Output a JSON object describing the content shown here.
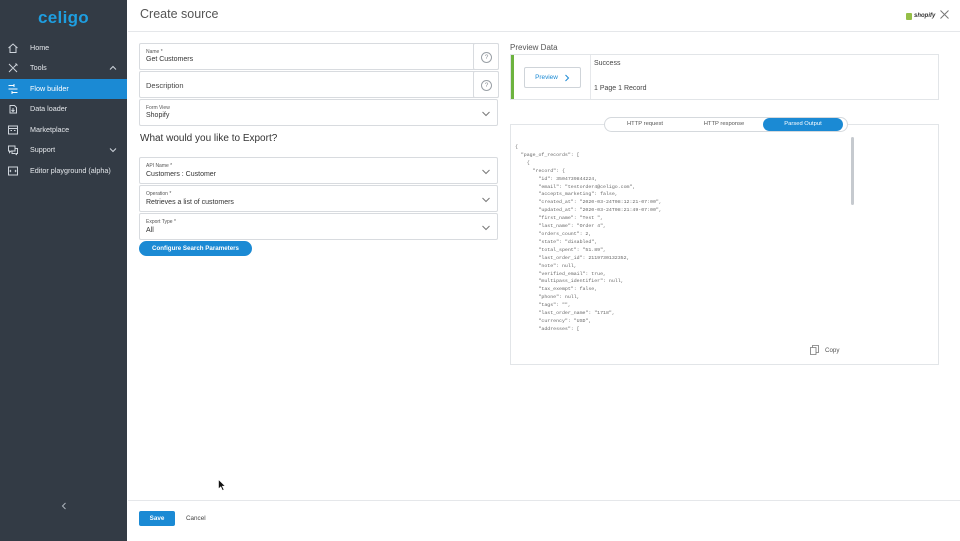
{
  "app": {
    "brand": "celigo",
    "brand_color": "#1e9ee0",
    "accent": "#1b8ad4",
    "success_color": "#6db33f"
  },
  "sidebar": {
    "items": [
      {
        "label": "Home",
        "icon": "home-icon"
      },
      {
        "label": "Tools",
        "icon": "tools-icon",
        "expanded": true
      },
      {
        "label": "Flow builder",
        "icon": "flow-builder-icon",
        "active": true
      },
      {
        "label": "Data loader",
        "icon": "data-loader-icon"
      },
      {
        "label": "Marketplace",
        "icon": "marketplace-icon"
      },
      {
        "label": "Support",
        "icon": "support-icon",
        "expanded": false
      },
      {
        "label": "Editor playground (alpha)",
        "icon": "editor-playground-icon"
      }
    ]
  },
  "header": {
    "title": "Create source",
    "app_logo": "shopify"
  },
  "form": {
    "name": {
      "label": "Name *",
      "value": "Get Customers"
    },
    "description": {
      "placeholder": "Description"
    },
    "form_view": {
      "label": "Form View",
      "value": "Shopify"
    },
    "export_heading": "What would you like to Export?",
    "api_name": {
      "label": "API Name *",
      "value": "Customers : Customer"
    },
    "operation": {
      "label": "Operation *",
      "value": "Retrieves a list of customers"
    },
    "export_type": {
      "label": "Export Type *",
      "value": "All"
    },
    "configure_button": "Configure Search Parameters"
  },
  "preview": {
    "heading": "Preview Data",
    "button": "Preview",
    "status": "Success",
    "count": "1 Page 1 Record",
    "tabs": [
      "HTTP request",
      "HTTP response",
      "Parsed Output"
    ],
    "active_tab": 2,
    "code_lines": [
      "{",
      "  \"page_of_records\": [",
      "    {",
      "      \"record\": {",
      "        \"id\": 3504739844224,",
      "        \"email\": \"testorder4@celigo.com\",",
      "        \"accepts_marketing\": false,",
      "        \"created_at\": \"2020-03-24T08:12:21-07:00\",",
      "        \"updated_at\": \"2020-03-24T08:21:49-07:00\",",
      "        \"first_name\": \"Test \",",
      "        \"last_name\": \"Order 4\",",
      "        \"orders_count\": 2,",
      "        \"state\": \"disabled\",",
      "        \"total_spent\": \"51.89\",",
      "        \"last_order_id\": 2119730132352,",
      "        \"note\": null,",
      "        \"verified_email\": true,",
      "        \"multipass_identifier\": null,",
      "        \"tax_exempt\": false,",
      "        \"phone\": null,",
      "        \"tags\": \"\",",
      "        \"last_order_name\": \"1718\",",
      "        \"currency\": \"USD\",",
      "        \"addresses\": ["
    ],
    "copy_label": "Copy"
  },
  "footer": {
    "save": "Save",
    "cancel": "Cancel"
  }
}
